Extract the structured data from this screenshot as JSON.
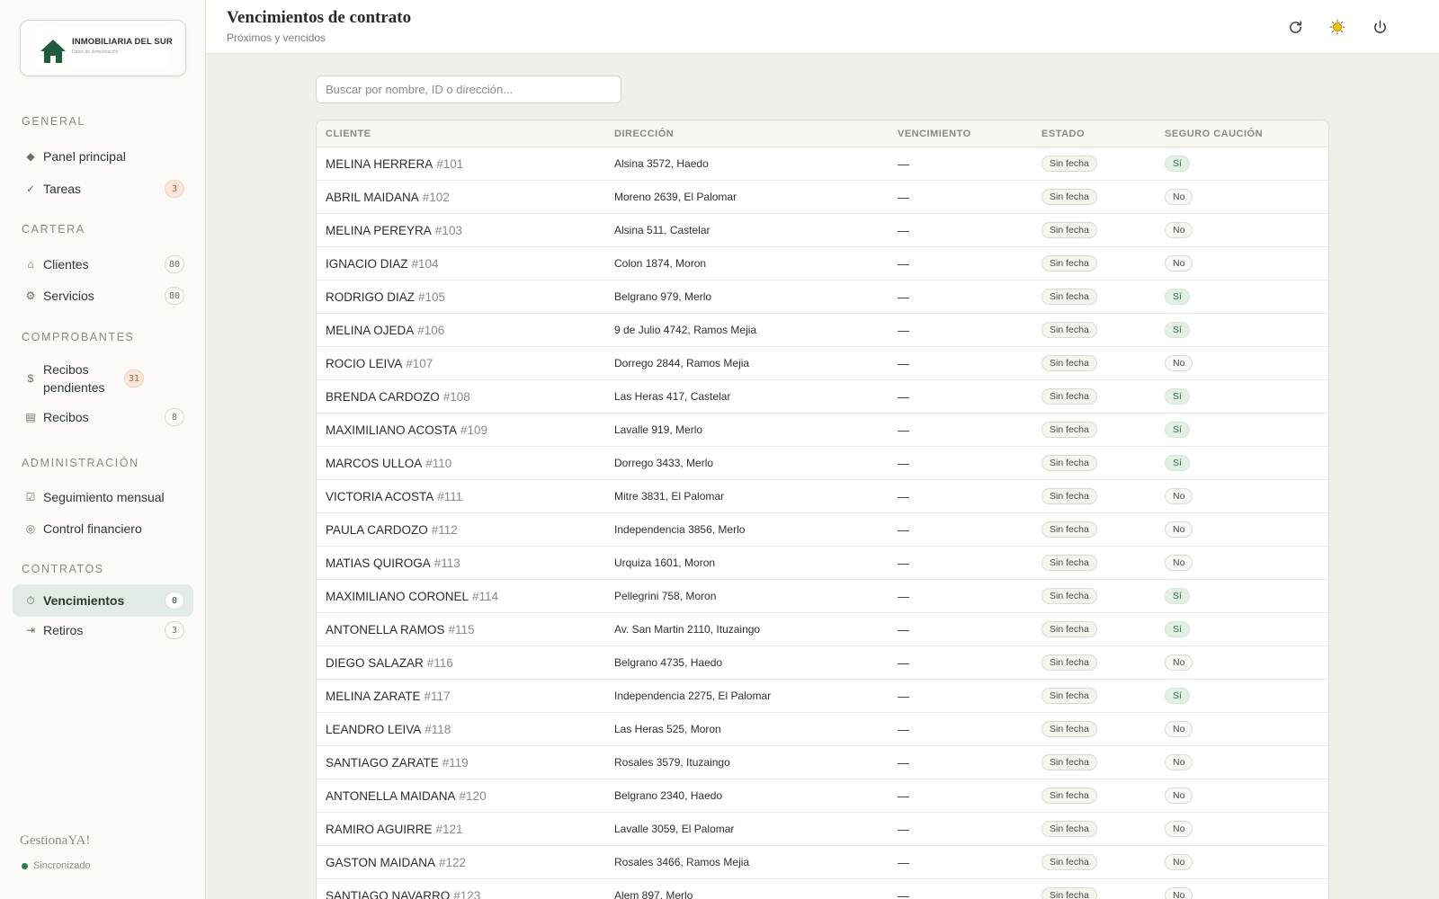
{
  "sidebar": {
    "logo": {
      "title": "INMOBILIARIA DEL SUR",
      "subtitle": "Datos de demostración"
    },
    "sections": [
      {
        "title": "GENERAL",
        "items": [
          {
            "icon": "diamond-icon",
            "glyph": "◆",
            "label": "Panel principal",
            "badge": ""
          },
          {
            "icon": "check-icon",
            "glyph": "✓",
            "label": "Tareas",
            "badge": "3",
            "badge_style": "warn"
          }
        ]
      },
      {
        "title": "CARTERA",
        "items": [
          {
            "icon": "home-icon",
            "glyph": "⌂",
            "label": "Clientes",
            "badge": "80"
          },
          {
            "icon": "gear-icon",
            "glyph": "⚙",
            "label": "Servicios",
            "badge": "80"
          }
        ]
      },
      {
        "title": "COMPROBANTES",
        "items": [
          {
            "icon": "dollar-icon",
            "glyph": "$",
            "label": "Recibos pendientes",
            "badge": "31",
            "badge_style": "warn"
          },
          {
            "icon": "receipt-icon",
            "glyph": "▤",
            "label": "Recibos",
            "badge": "8"
          }
        ]
      },
      {
        "title": "ADMINISTRACIÓN",
        "items": [
          {
            "icon": "checkbox-icon",
            "glyph": "☑",
            "label": "Seguimiento mensual",
            "badge": ""
          },
          {
            "icon": "circle-icon",
            "glyph": "◎",
            "label": "Control financiero",
            "badge": ""
          }
        ]
      },
      {
        "title": "CONTRATOS",
        "items": [
          {
            "icon": "stopwatch-icon",
            "glyph": "⏱",
            "label": "Vencimientos",
            "badge": "0",
            "active": true
          },
          {
            "icon": "exit-icon",
            "glyph": "⇥",
            "label": "Retiros",
            "badge": "3"
          }
        ]
      }
    ],
    "brand": "GestionaYA!",
    "sync_status": "Sincronizado"
  },
  "header": {
    "title": "Vencimientos de contrato",
    "subtitle": "Próximos y vencidos",
    "actions": [
      "refresh-icon",
      "sun-icon",
      "power-icon"
    ]
  },
  "search": {
    "placeholder": "Buscar por nombre, ID o dirección...",
    "value": ""
  },
  "table": {
    "columns": [
      "CLIENTE",
      "DIRECCIÓN",
      "VENCIMIENTO",
      "ESTADO",
      "SEGURO CAUCIÓN"
    ],
    "rows": [
      {
        "name": "MELINA HERRERA",
        "id": "#101",
        "address": "Alsina 3572, Haedo",
        "due": "—",
        "status": "Sin fecha",
        "insurance": "Sí"
      },
      {
        "name": "ABRIL MAIDANA",
        "id": "#102",
        "address": "Moreno 2639, El Palomar",
        "due": "—",
        "status": "Sin fecha",
        "insurance": "No"
      },
      {
        "name": "MELINA PEREYRA",
        "id": "#103",
        "address": "Alsina 511, Castelar",
        "due": "—",
        "status": "Sin fecha",
        "insurance": "No"
      },
      {
        "name": "IGNACIO DIAZ",
        "id": "#104",
        "address": "Colon 1874, Moron",
        "due": "—",
        "status": "Sin fecha",
        "insurance": "No"
      },
      {
        "name": "RODRIGO DIAZ",
        "id": "#105",
        "address": "Belgrano 979, Merlo",
        "due": "—",
        "status": "Sin fecha",
        "insurance": "Sí"
      },
      {
        "name": "MELINA OJEDA",
        "id": "#106",
        "address": "9 de Julio 4742, Ramos Mejia",
        "due": "—",
        "status": "Sin fecha",
        "insurance": "Sí"
      },
      {
        "name": "ROCIO LEIVA",
        "id": "#107",
        "address": "Dorrego 2844, Ramos Mejia",
        "due": "—",
        "status": "Sin fecha",
        "insurance": "No"
      },
      {
        "name": "BRENDA CARDOZO",
        "id": "#108",
        "address": "Las Heras 417, Castelar",
        "due": "—",
        "status": "Sin fecha",
        "insurance": "Sí"
      },
      {
        "name": "MAXIMILIANO ACOSTA",
        "id": "#109",
        "address": "Lavalle 919, Merlo",
        "due": "—",
        "status": "Sin fecha",
        "insurance": "Sí"
      },
      {
        "name": "MARCOS ULLOA",
        "id": "#110",
        "address": "Dorrego 3433, Merlo",
        "due": "—",
        "status": "Sin fecha",
        "insurance": "Sí"
      },
      {
        "name": "VICTORIA ACOSTA",
        "id": "#111",
        "address": "Mitre 3831, El Palomar",
        "due": "—",
        "status": "Sin fecha",
        "insurance": "No"
      },
      {
        "name": "PAULA CARDOZO",
        "id": "#112",
        "address": "Independencia 3856, Merlo",
        "due": "—",
        "status": "Sin fecha",
        "insurance": "No"
      },
      {
        "name": "MATIAS QUIROGA",
        "id": "#113",
        "address": "Urquiza 1601, Moron",
        "due": "—",
        "status": "Sin fecha",
        "insurance": "No"
      },
      {
        "name": "MAXIMILIANO CORONEL",
        "id": "#114",
        "address": "Pellegrini 758, Moron",
        "due": "—",
        "status": "Sin fecha",
        "insurance": "Sí"
      },
      {
        "name": "ANTONELLA RAMOS",
        "id": "#115",
        "address": "Av. San Martin 2110, Ituzaingo",
        "due": "—",
        "status": "Sin fecha",
        "insurance": "Sí"
      },
      {
        "name": "DIEGO SALAZAR",
        "id": "#116",
        "address": "Belgrano 4735, Haedo",
        "due": "—",
        "status": "Sin fecha",
        "insurance": "No"
      },
      {
        "name": "MELINA ZARATE",
        "id": "#117",
        "address": "Independencia 2275, El Palomar",
        "due": "—",
        "status": "Sin fecha",
        "insurance": "Sí"
      },
      {
        "name": "LEANDRO LEIVA",
        "id": "#118",
        "address": "Las Heras 525, Moron",
        "due": "—",
        "status": "Sin fecha",
        "insurance": "No"
      },
      {
        "name": "SANTIAGO ZARATE",
        "id": "#119",
        "address": "Rosales 3579, Ituzaingo",
        "due": "—",
        "status": "Sin fecha",
        "insurance": "No"
      },
      {
        "name": "ANTONELLA MAIDANA",
        "id": "#120",
        "address": "Belgrano 2340, Haedo",
        "due": "—",
        "status": "Sin fecha",
        "insurance": "No"
      },
      {
        "name": "RAMIRO AGUIRRE",
        "id": "#121",
        "address": "Lavalle 3059, El Palomar",
        "due": "—",
        "status": "Sin fecha",
        "insurance": "No"
      },
      {
        "name": "GASTON MAIDANA",
        "id": "#122",
        "address": "Rosales 3466, Ramos Mejia",
        "due": "—",
        "status": "Sin fecha",
        "insurance": "No"
      },
      {
        "name": "SANTIAGO NAVARRO",
        "id": "#123",
        "address": "Alem 897, Merlo",
        "due": "—",
        "status": "Sin fecha",
        "insurance": "No"
      }
    ]
  },
  "colors": {
    "accent_green": "#2f7a4a",
    "active_nav_bg": "#e3ece4",
    "warn_badge_bg": "#fbe6dc",
    "page_bg": "#f1efe9"
  }
}
